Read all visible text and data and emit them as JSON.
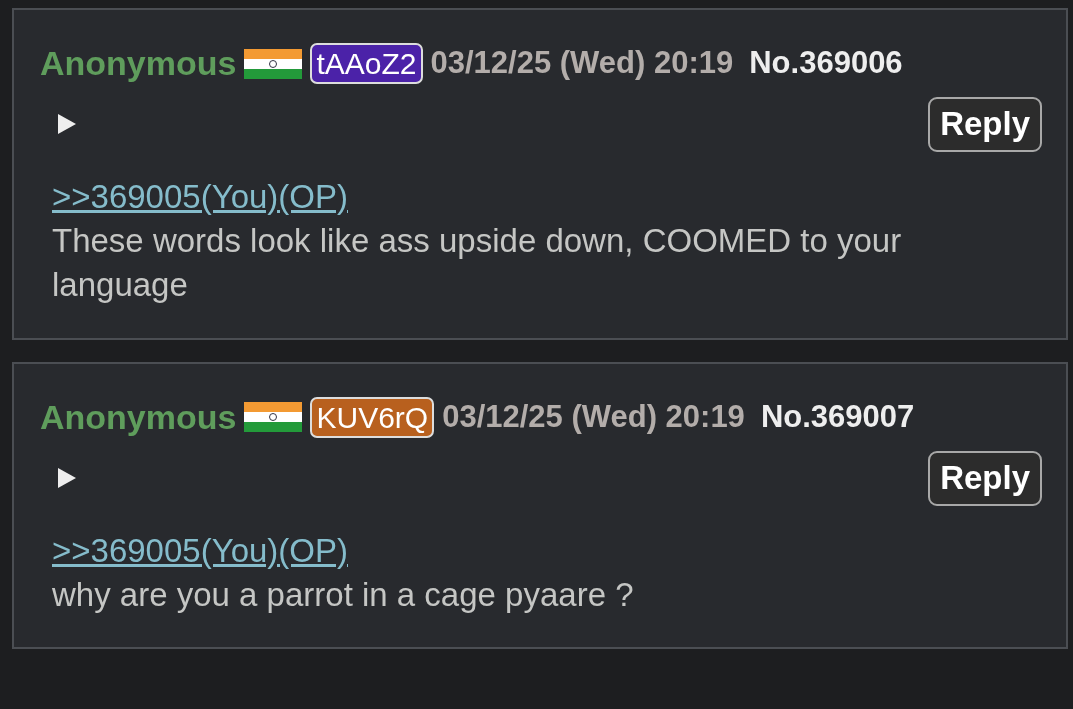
{
  "posts": [
    {
      "name": "Anonymous",
      "poster_id": "tAAoZ2",
      "color": "#4b22a8",
      "date": "03/12/25 (Wed) 20:19",
      "number": "No.369006",
      "reply": "Reply",
      "quote": ">>369005(You)(OP)",
      "body": "These words look like ass upside down, COOMED to your language"
    },
    {
      "name": "Anonymous",
      "poster_id": "KUV6rQ",
      "color": "#b8601e",
      "date": "03/12/25 (Wed) 20:19",
      "number": "No.369007",
      "reply": "Reply",
      "quote": ">>369005(You)(OP)",
      "body": "why are you a parrot in a cage pyaare ?"
    }
  ]
}
